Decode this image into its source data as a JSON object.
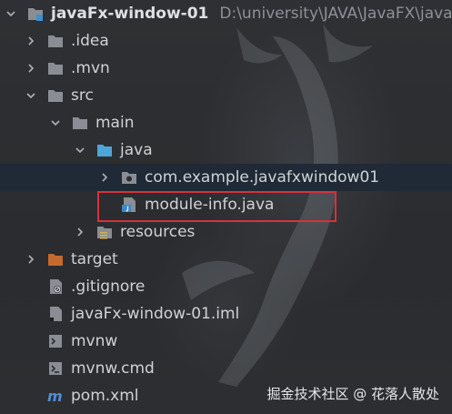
{
  "tree": {
    "root": {
      "label": "javaFx-window-01",
      "path": "D:\\university\\JAVA\\JavaFX\\java",
      "icon": "module-folder-icon"
    },
    "items": [
      {
        "label": ".idea",
        "icon": "folder-icon"
      },
      {
        "label": ".mvn",
        "icon": "folder-icon"
      },
      {
        "label": "src",
        "icon": "folder-icon"
      },
      {
        "label": "main",
        "icon": "folder-icon"
      },
      {
        "label": "java",
        "icon": "source-folder-icon"
      },
      {
        "label": "com.example.javafxwindow01",
        "icon": "package-icon"
      },
      {
        "label": "module-info.java",
        "icon": "java-file-icon"
      },
      {
        "label": "resources",
        "icon": "resources-folder-icon"
      },
      {
        "label": "target",
        "icon": "excluded-folder-icon"
      },
      {
        "label": ".gitignore",
        "icon": "ignore-file-icon"
      },
      {
        "label": "javaFx-window-01.iml",
        "icon": "iml-file-icon"
      },
      {
        "label": "mvnw",
        "icon": "terminal-file-icon"
      },
      {
        "label": "mvnw.cmd",
        "icon": "cmd-file-icon"
      },
      {
        "label": "pom.xml",
        "icon": "maven-file-icon"
      }
    ]
  },
  "colors": {
    "background": "#2b2d30",
    "text": "#cfd2d6",
    "path_text": "#8d9197",
    "selection": "#1f2a36",
    "highlight_box": "#d8313a",
    "folder": "#8a8e94",
    "source_folder": "#4ea6d8",
    "excluded_folder": "#c36a2c"
  },
  "watermark": "掘金技术社区 @ 花落人散处"
}
